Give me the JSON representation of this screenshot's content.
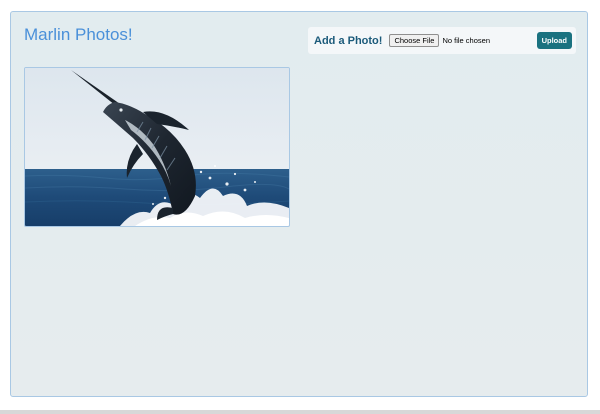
{
  "app": {
    "title": "Marlin Photos!"
  },
  "upload": {
    "heading": "Add a Photo!",
    "choose_label": "Choose File",
    "file_status": "No file chosen",
    "submit_label": "Upload"
  },
  "gallery": {
    "photos": [
      {
        "subject": "marlin-jumping"
      }
    ]
  },
  "colors": {
    "title": "#4a90d9",
    "accent": "#1a7280",
    "border": "#a9c8e4",
    "background": "#e2ecef"
  }
}
